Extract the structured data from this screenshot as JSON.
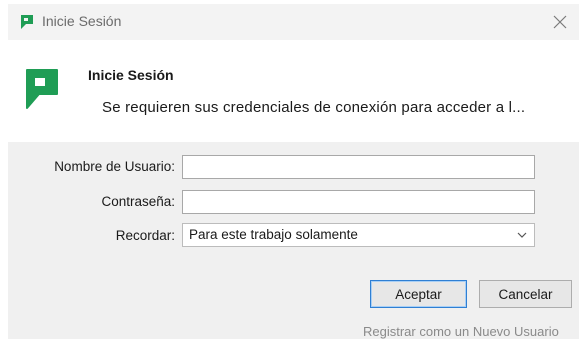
{
  "window": {
    "title": "Inicie Sesión",
    "brand_color": "#1f9d55"
  },
  "header": {
    "title": "Inicie Sesión",
    "subtitle": "Se requieren sus credenciales de conexión para acceder a l..."
  },
  "form": {
    "username": {
      "label": "Nombre de Usuario:",
      "value": ""
    },
    "password": {
      "label": "Contraseña:",
      "value": ""
    },
    "remember": {
      "label": "Recordar:",
      "selected": "Para este trabajo solamente"
    }
  },
  "buttons": {
    "ok_label": "Aceptar",
    "cancel_label": "Cancelar"
  },
  "footer": {
    "register_label": "Registrar como un Nuevo Usuario"
  },
  "icons": {
    "app": "app-logo-icon",
    "close": "close-icon",
    "dropdown": "chevron-down-icon"
  }
}
